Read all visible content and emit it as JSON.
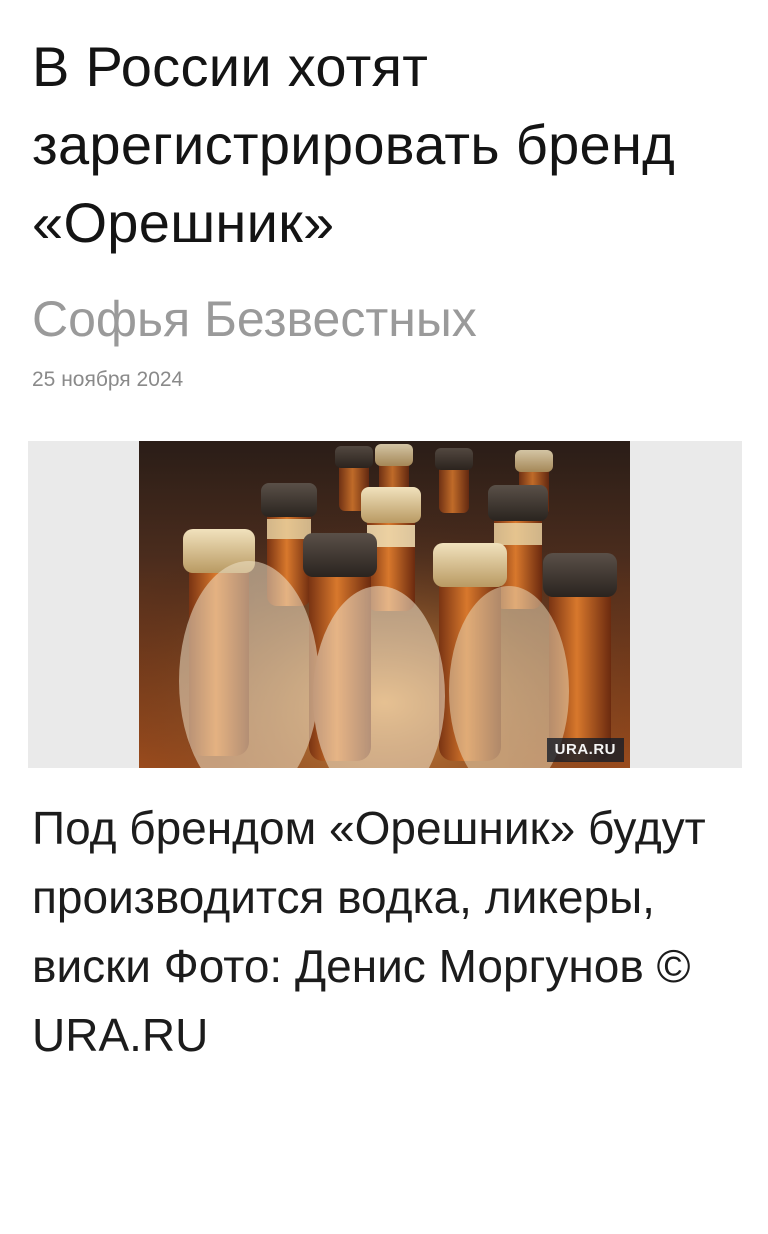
{
  "article": {
    "headline": "В России хотят зарегистрировать бренд «Орешник»",
    "author": "Софья Безвестных",
    "date": "25 ноября 2024",
    "photo": {
      "watermark": "URA.RU",
      "subject": "bottles-icon"
    },
    "caption": "Под брендом «Орешник» будут производится водка, ликеры, виски Фото: Денис Моргунов © URA.RU"
  }
}
